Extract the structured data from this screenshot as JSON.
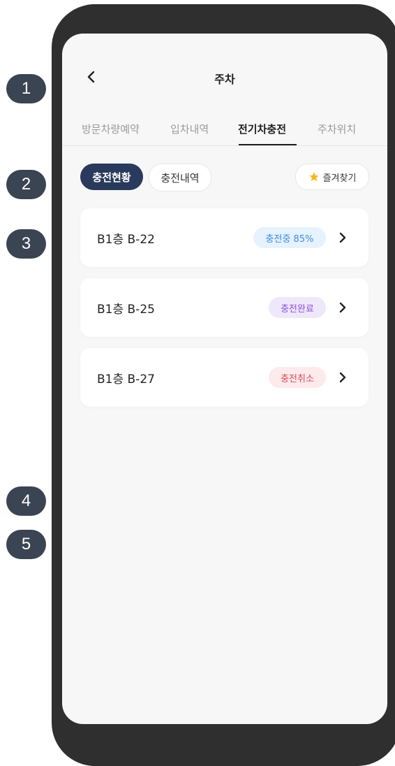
{
  "markers": [
    "1",
    "2",
    "3",
    "4",
    "5"
  ],
  "header": {
    "title": "주차"
  },
  "tabs": [
    {
      "label": "방문차량예약"
    },
    {
      "label": "입차내역"
    },
    {
      "label": "전기차충전"
    },
    {
      "label": "주차위치"
    }
  ],
  "filters": {
    "primary": "충전현황",
    "secondary": "충전내역",
    "favorite": "즐겨찾기"
  },
  "cards": [
    {
      "title": "B1층 B-22",
      "status": "충전중 85%"
    },
    {
      "title": "B1층 B-25",
      "status": "충전완료"
    },
    {
      "title": "B1층 B-27",
      "status": "충전취소"
    }
  ],
  "colors": {
    "charging_bg": "#e6f2fd",
    "charging_text": "#3d8ee0",
    "complete_bg": "#efe8fb",
    "complete_text": "#8a53d6",
    "cancel_bg": "#fdeaec",
    "cancel_text": "#e04a5a",
    "primary_pill": "#2a3a5c",
    "star": "#f6b81d"
  }
}
